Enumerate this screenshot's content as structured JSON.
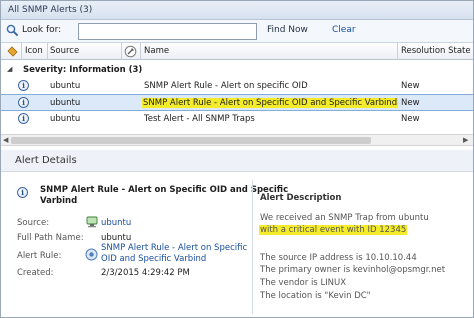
{
  "window": {
    "title": "All SNMP Alerts (3)"
  },
  "toolbar": {
    "look_for_label": "Look for:",
    "search_value": "",
    "find_now": "Find Now",
    "clear": "Clear"
  },
  "columns": {
    "icon": "Icon",
    "source": "Source",
    "name": "Name",
    "resolution_state": "Resolution State"
  },
  "group": {
    "label": "Severity: Information (3)"
  },
  "alerts": [
    {
      "source": "ubuntu",
      "name": "SNMP Alert Rule - Alert on specific OID",
      "state": "New"
    },
    {
      "source": "ubuntu",
      "name": "SNMP Alert Rule - Alert on Specific OID and Specific Varbind",
      "state": "New"
    },
    {
      "source": "ubuntu",
      "name": "Test Alert  - All SNMP Traps",
      "state": "New"
    }
  ],
  "details": {
    "heading": "Alert Details",
    "title": "SNMP Alert Rule - Alert on Specific OID and Specific Varbind",
    "title_line1": "SNMP Alert Rule - Alert on Specific OID and Specific",
    "title_line2": "Varbind",
    "source_label": "Source:",
    "source_value": "ubuntu",
    "path_label": "Full Path Name:",
    "path_value": "ubuntu",
    "rule_label": "Alert Rule:",
    "rule_line1": "SNMP Alert Rule - Alert on Specific",
    "rule_line2": "OID and Specific Varbind",
    "created_label": "Created:",
    "created_value": "2/3/2015 4:29:42 PM"
  },
  "description": {
    "heading": "Alert Description",
    "line1": "We received an SNMP Trap from ubuntu",
    "line2": "with a critical event with ID 12345",
    "line3": "The source IP address is 10.10.10.44",
    "line4": "The primary owner is kevinhol@opsmgr.net",
    "line5": "The vendor is LINUX",
    "line6": "The location is \"Kevin DC\""
  },
  "colors": {
    "highlight": "#f4ec2a",
    "selection": "#dbe9f8",
    "link": "#1a4fa0"
  }
}
